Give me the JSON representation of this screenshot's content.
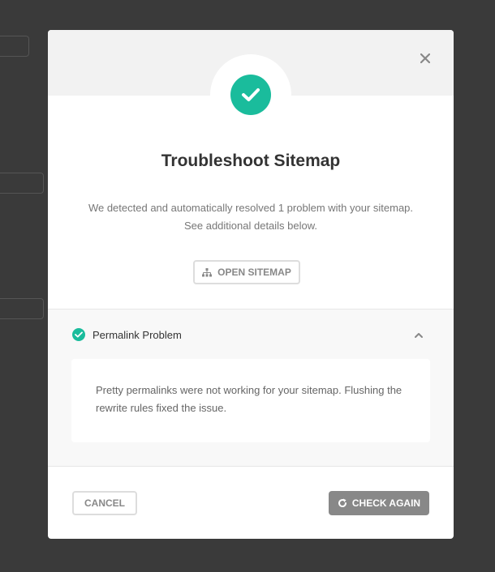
{
  "modal": {
    "title": "Troubleshoot Sitemap",
    "description": "We detected and automatically resolved 1 problem with your sitemap. See additional details below.",
    "open_sitemap_label": "OPEN SITEMAP",
    "cancel_label": "CANCEL",
    "check_again_label": "CHECK AGAIN"
  },
  "issue": {
    "title": "Permalink Problem",
    "details": "Pretty permalinks were not working for your sitemap. Flushing the rewrite rules fixed the issue.",
    "status": "resolved",
    "expanded": true
  },
  "icons": {
    "close": "close-icon",
    "success": "check-circle-icon",
    "sitemap": "sitemap-icon",
    "chevron": "chevron-up-icon",
    "refresh": "refresh-icon"
  },
  "colors": {
    "success": "#1abc9c",
    "primary_button": "#888888",
    "overlay": "#3a3a3a"
  }
}
